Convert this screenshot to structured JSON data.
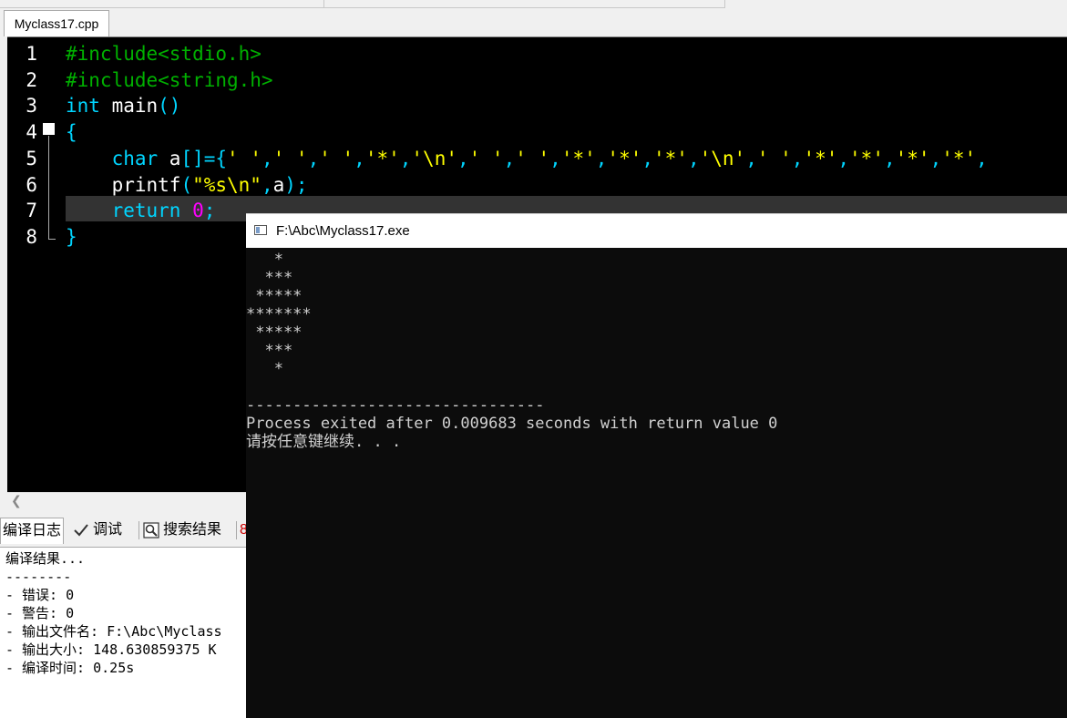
{
  "editor": {
    "file_tab": "Myclass17.cpp",
    "line_numbers": [
      "1",
      "2",
      "3",
      "4",
      "5",
      "6",
      "7",
      "8"
    ],
    "lines": [
      [
        {
          "t": "#include<stdio.h>",
          "c": "pre"
        }
      ],
      [
        {
          "t": "#include<string.h>",
          "c": "pre"
        }
      ],
      [
        {
          "t": "int",
          "c": "key"
        },
        {
          "t": " main",
          "c": "plain"
        },
        {
          "t": "()",
          "c": "punc"
        }
      ],
      [
        {
          "t": "{",
          "c": "punc"
        }
      ],
      [
        {
          "t": "    char",
          "c": "key"
        },
        {
          "t": " a",
          "c": "plain"
        },
        {
          "t": "[]={",
          "c": "punc"
        },
        {
          "t": "' '",
          "c": "str"
        },
        {
          "t": ",",
          "c": "punc"
        },
        {
          "t": "' '",
          "c": "str"
        },
        {
          "t": ",",
          "c": "punc"
        },
        {
          "t": "' '",
          "c": "str"
        },
        {
          "t": ",",
          "c": "punc"
        },
        {
          "t": "'*'",
          "c": "str"
        },
        {
          "t": ",",
          "c": "punc"
        },
        {
          "t": "'\\n'",
          "c": "str"
        },
        {
          "t": ",",
          "c": "punc"
        },
        {
          "t": "' '",
          "c": "str"
        },
        {
          "t": ",",
          "c": "punc"
        },
        {
          "t": "' '",
          "c": "str"
        },
        {
          "t": ",",
          "c": "punc"
        },
        {
          "t": "'*'",
          "c": "str"
        },
        {
          "t": ",",
          "c": "punc"
        },
        {
          "t": "'*'",
          "c": "str"
        },
        {
          "t": ",",
          "c": "punc"
        },
        {
          "t": "'*'",
          "c": "str"
        },
        {
          "t": ",",
          "c": "punc"
        },
        {
          "t": "'\\n'",
          "c": "str"
        },
        {
          "t": ",",
          "c": "punc"
        },
        {
          "t": "' '",
          "c": "str"
        },
        {
          "t": ",",
          "c": "punc"
        },
        {
          "t": "'*'",
          "c": "str"
        },
        {
          "t": ",",
          "c": "punc"
        },
        {
          "t": "'*'",
          "c": "str"
        },
        {
          "t": ",",
          "c": "punc"
        },
        {
          "t": "'*'",
          "c": "str"
        },
        {
          "t": ",",
          "c": "punc"
        },
        {
          "t": "'*'",
          "c": "str"
        },
        {
          "t": ",",
          "c": "punc"
        }
      ],
      [
        {
          "t": "    printf",
          "c": "plain"
        },
        {
          "t": "(",
          "c": "punc"
        },
        {
          "t": "\"%s\\n\"",
          "c": "str"
        },
        {
          "t": ",",
          "c": "punc"
        },
        {
          "t": "a",
          "c": "plain"
        },
        {
          "t": ");",
          "c": "punc"
        }
      ],
      [
        {
          "t": "    return",
          "c": "key"
        },
        {
          "t": " ",
          "c": "plain"
        },
        {
          "t": "0",
          "c": "num"
        },
        {
          "t": ";",
          "c": "punc"
        }
      ],
      [
        {
          "t": "}",
          "c": "punc"
        }
      ]
    ]
  },
  "bottom_tabs": {
    "compile_log": "编译日志",
    "debug": "调试",
    "search_results": "搜索结果",
    "truncated": "8"
  },
  "compile_log": {
    "lines": [
      "编译结果...",
      "--------",
      "- 错误: 0",
      "- 警告: 0",
      "- 输出文件名: F:\\Abc\\Myclass",
      "- 输出大小: 148.630859375 K",
      "- 编译时间: 0.25s"
    ]
  },
  "console": {
    "title": "F:\\Abc\\Myclass17.exe",
    "output": [
      "   *",
      "  ***",
      " *****",
      "*******",
      " *****",
      "  ***",
      "   *",
      "",
      "--------------------------------",
      "Process exited after 0.009683 seconds with return value 0",
      "请按任意键继续. . ."
    ]
  },
  "colors": {
    "preprocessor": "#00b000",
    "keyword": "#00d5ff",
    "string": "#ffff00",
    "number": "#ff00ff",
    "editor_bg": "#000000",
    "console_bg": "#0c0c0c"
  }
}
